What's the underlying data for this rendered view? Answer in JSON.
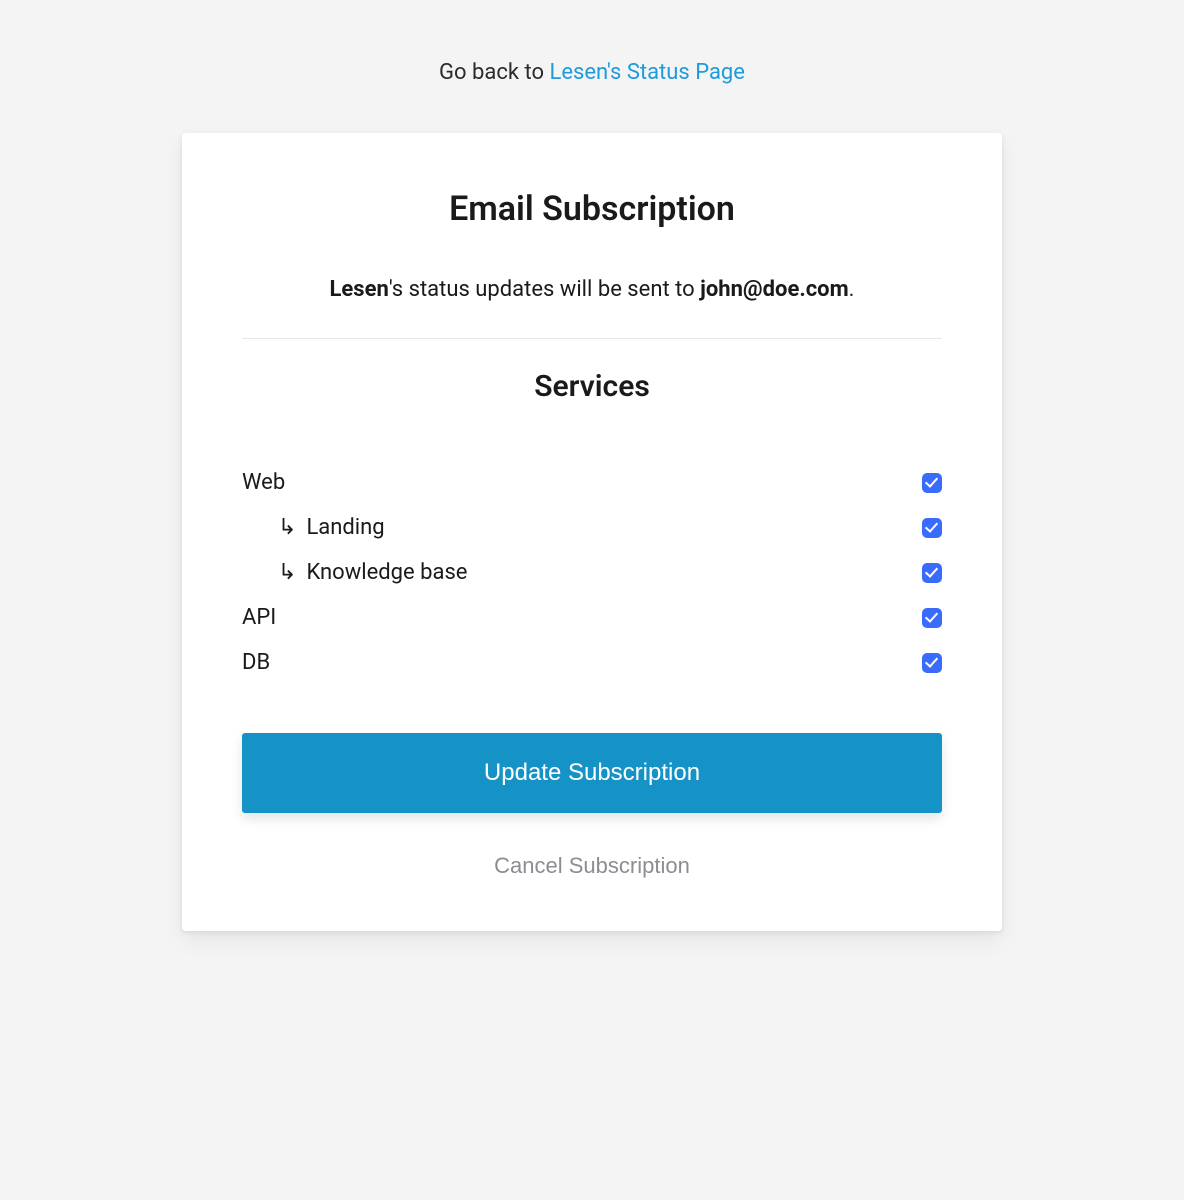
{
  "back": {
    "prefix": "Go back to ",
    "link_text": "Lesen's Status Page"
  },
  "card": {
    "title": "Email Subscription",
    "org_name": "Lesen",
    "intro_mid": "'s status updates will be sent to ",
    "email": "john@doe.com",
    "intro_suffix": ".",
    "services_heading": "Services"
  },
  "services": [
    {
      "name": "Web",
      "checked": true,
      "child": false
    },
    {
      "name": "Landing",
      "checked": true,
      "child": true
    },
    {
      "name": "Knowledge base",
      "checked": true,
      "child": true
    },
    {
      "name": "API",
      "checked": true,
      "child": false
    },
    {
      "name": "DB",
      "checked": true,
      "child": false
    }
  ],
  "buttons": {
    "update": "Update Subscription",
    "cancel": "Cancel Subscription"
  },
  "icons": {
    "child_arrow": "↳"
  }
}
